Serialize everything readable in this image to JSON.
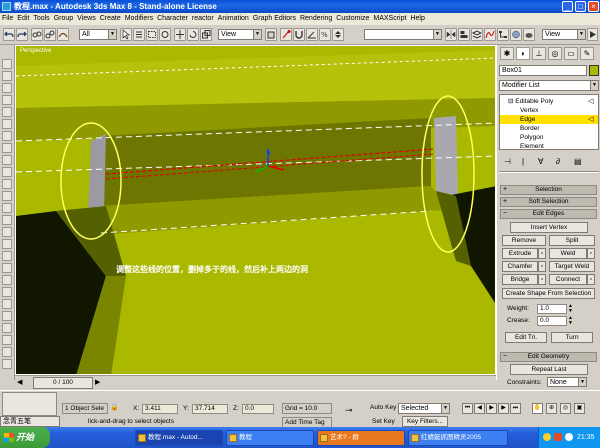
{
  "window": {
    "title": "教程.max - Autodesk 3ds Max 8 - Stand-alone License"
  },
  "menu": [
    "File",
    "Edit",
    "Tools",
    "Group",
    "Views",
    "Create",
    "Modifiers",
    "Character",
    "reactor",
    "Animation",
    "Graph Editors",
    "Rendering",
    "Customize",
    "MAXScript",
    "Help"
  ],
  "toolbar": {
    "selection_filter": "All",
    "ref_coord_1": "View",
    "ref_coord_2": "View",
    "named_selection": ""
  },
  "viewport": {
    "label": "Perspective",
    "caption": "调整这些线的位置，删掉多于的线，然后补上两边的洞"
  },
  "panel": {
    "object_name": "Box01",
    "modifier_list": "Modifier List",
    "stack": [
      {
        "label": "Editable Poly",
        "level": 0,
        "selected": false
      },
      {
        "label": "Vertex",
        "level": 1,
        "selected": false
      },
      {
        "label": "Edge",
        "level": 1,
        "selected": true
      },
      {
        "label": "Border",
        "level": 1,
        "selected": false
      },
      {
        "label": "Polygon",
        "level": 1,
        "selected": false
      },
      {
        "label": "Element",
        "level": 1,
        "selected": false
      }
    ],
    "rollouts": {
      "selection": "Selection",
      "soft_selection": "Soft Selection",
      "edit_edges": "Edit Edges",
      "edit_geometry": "Edit Geometry"
    },
    "edit_edges": {
      "insert_vertex": "Insert Vertex",
      "remove": "Remove",
      "split": "Split",
      "extrude": "Extrude",
      "weld": "Weld",
      "chamfer": "Chamfer",
      "target_weld": "Target Weld",
      "bridge": "Bridge",
      "connect": "Connect",
      "create_shape": "Create Shape From Selection",
      "weight_label": "Weight:",
      "weight_value": "1.0",
      "crease_label": "Crease:",
      "crease_value": "0.0",
      "edit_tri": "Edit Tri.",
      "turn": "Turn"
    },
    "edit_geometry": {
      "repeat_last": "Repeat Last",
      "constraints_label": "Constraints:",
      "constraints_value": "None"
    }
  },
  "timeline": {
    "slider": "0 / 100"
  },
  "status": {
    "selection_count": "1 Object Sele",
    "prompt": "lick-and-drag to select objects",
    "x_label": "X:",
    "x_value": "3.411",
    "y_label": "Y:",
    "y_value": "37.714",
    "z_label": "Z:",
    "z_value": "0.0",
    "grid": "Grid = 10.0",
    "add_time_tag": "Add Time Tag",
    "auto_key": "Auto Key",
    "set_key": "Set Key",
    "key_mode": "Selected",
    "key_filters": "Key Filters..."
  },
  "ime": "念青五笔",
  "taskbar": {
    "start": "开始",
    "tasks": [
      "教程.max - Autod...",
      "教程",
      "艺术? - 群",
      "红蜻蜓抓图精灵2005"
    ],
    "clock": "21:35"
  }
}
